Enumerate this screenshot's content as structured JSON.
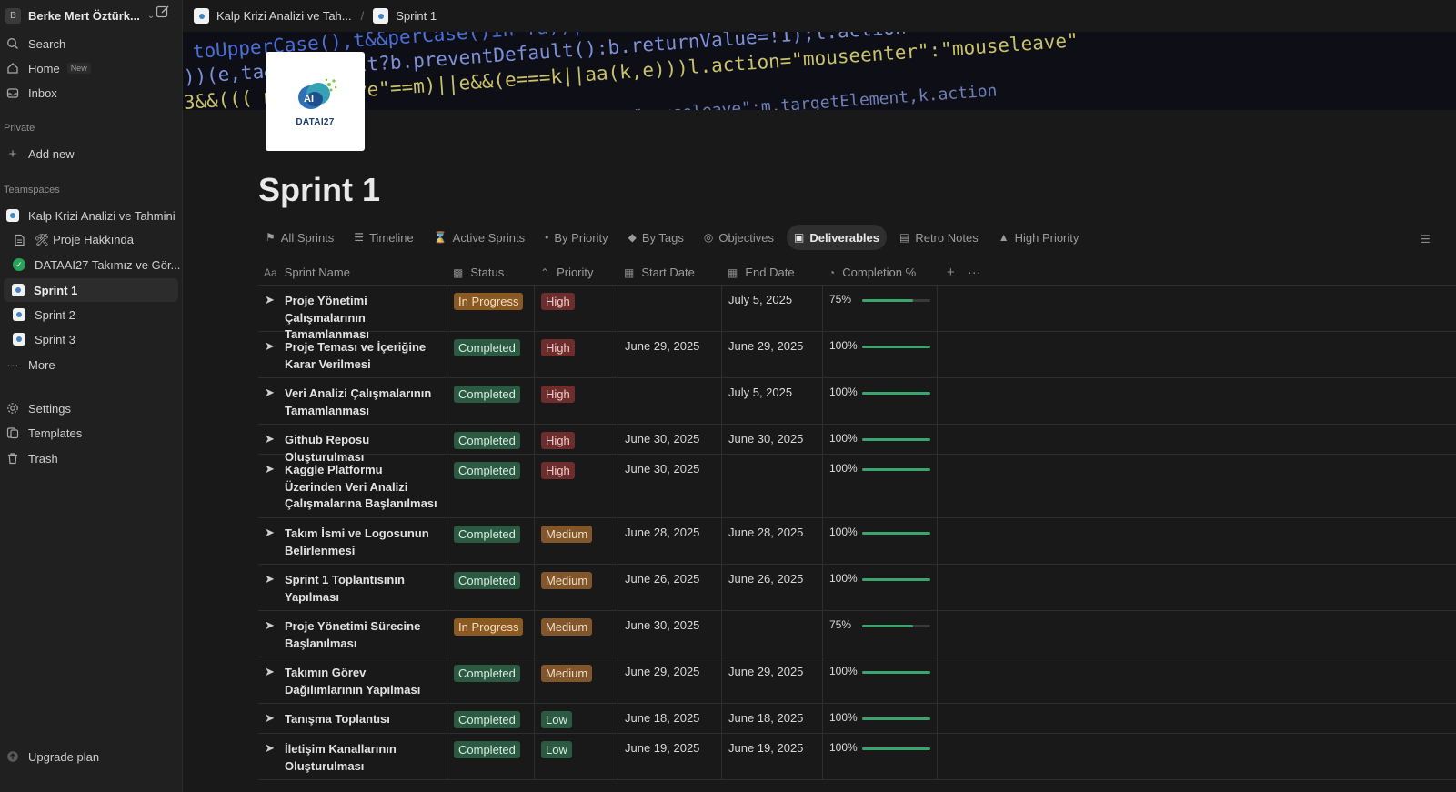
{
  "workspace": {
    "avatar": "B",
    "name": "Berke Mert Öztürk..."
  },
  "sidebar": {
    "nav": [
      {
        "label": "Search",
        "icon": "search-icon"
      },
      {
        "label": "Home",
        "icon": "home-icon",
        "badge": "New"
      },
      {
        "label": "Inbox",
        "icon": "inbox-icon"
      }
    ],
    "private_label": "Private",
    "add_new": "Add new",
    "teamspaces_label": "Teamspaces",
    "pages": [
      {
        "label": "Kalp Krizi Analizi ve Tahmini",
        "icon": "teamspace-logo-icon"
      },
      {
        "label": "🛠 Proje Hakkında",
        "icon": "document-icon"
      },
      {
        "label": "DATAAI27 Takımız ve Gör...",
        "icon": "check-circle-icon"
      },
      {
        "label": "Sprint 1",
        "icon": "page-logo-icon",
        "active": true
      },
      {
        "label": "Sprint 2",
        "icon": "page-logo-icon"
      },
      {
        "label": "Sprint 3",
        "icon": "page-logo-icon"
      },
      {
        "label": "More",
        "icon": "more-dots-icon"
      }
    ],
    "footer_links": [
      {
        "label": "Settings",
        "icon": "gear-icon"
      },
      {
        "label": "Templates",
        "icon": "templates-icon"
      },
      {
        "label": "Trash",
        "icon": "trash-icon"
      }
    ],
    "upgrade": "Upgrade plan"
  },
  "breadcrumbs": [
    "Kalp Krizi Analizi ve Tah...",
    "Sprint 1"
  ],
  "page": {
    "title": "Sprint 1",
    "logo_text": "DATAI27"
  },
  "tabs": [
    {
      "label": "All Sprints",
      "icon": "flag-icon"
    },
    {
      "label": "Timeline",
      "icon": "timeline-icon"
    },
    {
      "label": "Active Sprints",
      "icon": "hourglass-icon"
    },
    {
      "label": "By Priority",
      "icon": "pin-icon"
    },
    {
      "label": "By Tags",
      "icon": "tag-icon"
    },
    {
      "label": "Objectives",
      "icon": "target-icon"
    },
    {
      "label": "Deliverables",
      "icon": "archive-icon",
      "active": true
    },
    {
      "label": "Retro Notes",
      "icon": "document-icon"
    },
    {
      "label": "High Priority",
      "icon": "fire-icon"
    }
  ],
  "table": {
    "columns": [
      "Sprint Name",
      "Status",
      "Priority",
      "Start Date",
      "End Date",
      "Completion %"
    ],
    "rows": [
      {
        "name": "Proje Yönetimi Çalışmalarının Tamamlanması",
        "status": "In Progress",
        "priority": "High",
        "start": "",
        "end": "July 5, 2025",
        "completion": "75%",
        "progress": 0.75
      },
      {
        "name": "Proje Teması ve İçeriğine Karar Verilmesi",
        "status": "Completed",
        "priority": "High",
        "start": "June 29, 2025",
        "end": "June 29, 2025",
        "completion": "100%",
        "progress": 1.0
      },
      {
        "name": "Veri Analizi Çalışmalarının Tamamlanması",
        "status": "Completed",
        "priority": "High",
        "start": "",
        "end": "July 5, 2025",
        "completion": "100%",
        "progress": 1.0
      },
      {
        "name": "Github Reposu Oluşturulması",
        "status": "Completed",
        "priority": "High",
        "start": "June 30, 2025",
        "end": "June 30, 2025",
        "completion": "100%",
        "progress": 1.0
      },
      {
        "name": "Kaggle Platformu Üzerinden Veri Analizi Çalışmalarına Başlanılması",
        "status": "Completed",
        "priority": "High",
        "start": "June 30, 2025",
        "end": "",
        "completion": "100%",
        "progress": 1.0
      },
      {
        "name": "Takım İsmi ve Logosunun Belirlenmesi",
        "status": "Completed",
        "priority": "Medium",
        "start": "June 28, 2025",
        "end": "June 28, 2025",
        "completion": "100%",
        "progress": 1.0
      },
      {
        "name": "Sprint 1 Toplantısının Yapılması",
        "status": "Completed",
        "priority": "Medium",
        "start": "June 26, 2025",
        "end": "June 26, 2025",
        "completion": "100%",
        "progress": 1.0
      },
      {
        "name": "Proje Yönetimi Sürecine Başlanılması",
        "status": "In Progress",
        "priority": "Medium",
        "start": "June 30, 2025",
        "end": "",
        "completion": "75%",
        "progress": 0.75
      },
      {
        "name": "Takımın Görev Dağılımlarının Yapılması",
        "status": "Completed",
        "priority": "Medium",
        "start": "June 29, 2025",
        "end": "June 29, 2025",
        "completion": "100%",
        "progress": 1.0
      },
      {
        "name": "Tanışma Toplantısı",
        "status": "Completed",
        "priority": "Low",
        "start": "June 18, 2025",
        "end": "June 18, 2025",
        "completion": "100%",
        "progress": 1.0
      },
      {
        "name": "İletişim Kanallarının Oluşturulması",
        "status": "Completed",
        "priority": "Low",
        "start": "June 19, 2025",
        "end": "June 19, 2025",
        "completion": "100%",
        "progress": 1.0
      }
    ]
  },
  "colors": {
    "background": "#191919",
    "sidebar": "#202020",
    "completed": "#2b5941",
    "in_progress": "#8a5a22",
    "high": "#6e2d2d",
    "medium": "#80562a",
    "progress_fill": "#3aa56e"
  }
}
